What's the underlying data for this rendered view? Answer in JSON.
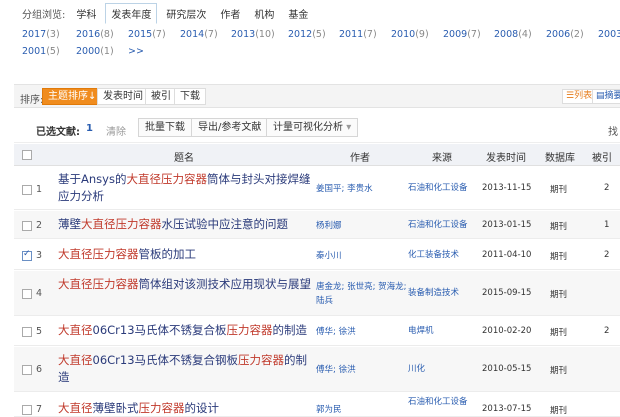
{
  "group_nav": {
    "label": "分组浏览:",
    "tabs": [
      {
        "label": "学科",
        "active": false
      },
      {
        "label": "发表年度",
        "active": true
      },
      {
        "label": "研究层次",
        "active": false
      },
      {
        "label": "作者",
        "active": false
      },
      {
        "label": "机构",
        "active": false
      },
      {
        "label": "基金",
        "active": false
      }
    ],
    "years": [
      {
        "year": "2017",
        "count": "(3)"
      },
      {
        "year": "2016",
        "count": "(8)"
      },
      {
        "year": "2015",
        "count": "(7)"
      },
      {
        "year": "2014",
        "count": "(7)"
      },
      {
        "year": "2013",
        "count": "(10)"
      },
      {
        "year": "2012",
        "count": "(5)"
      },
      {
        "year": "2011",
        "count": "(7)"
      },
      {
        "year": "2010",
        "count": "(9)"
      },
      {
        "year": "2009",
        "count": "(7)"
      },
      {
        "year": "2008",
        "count": "(4)"
      },
      {
        "year": "2006",
        "count": "(2)"
      },
      {
        "year": "2003",
        "count": ""
      },
      {
        "year": "2001",
        "count": "(5)"
      },
      {
        "year": "2000",
        "count": "(1)"
      },
      {
        "year": ">>",
        "count": ""
      }
    ]
  },
  "sort_bar": {
    "label": "排序:",
    "buttons": [
      {
        "label": "主题排序↓",
        "active": true
      },
      {
        "label": "发表时间",
        "active": false
      },
      {
        "label": "被引",
        "active": false
      },
      {
        "label": "下载",
        "active": false
      }
    ],
    "view_list": "☰列表",
    "view_abstract": "▤摘要"
  },
  "action_bar": {
    "selected_label": "已选文献:",
    "selected_count": "1",
    "clear_label": "清除",
    "batch_download": "批量下载",
    "export": "导出/参考文献",
    "visualize": "计量可视化分析",
    "visualize_caret": "▾",
    "right_text": "找"
  },
  "table": {
    "headers": {
      "title": "题名",
      "author": "作者",
      "source": "来源",
      "date": "发表时间",
      "db": "数据库",
      "cite": "被引"
    },
    "rows": [
      {
        "num": "1",
        "checked": false,
        "title_parts": [
          {
            "t": "基于Ansys的",
            "h": false
          },
          {
            "t": "大直径压力容器",
            "h": true
          },
          {
            "t": "筒体与封头对接焊缝应力分析",
            "h": false
          }
        ],
        "author": "姜国平; 李贵水",
        "source": "石油和化工设备",
        "date": "2013-11-15",
        "db": "期刊",
        "cite": "2"
      },
      {
        "num": "2",
        "checked": false,
        "title_parts": [
          {
            "t": "薄壁",
            "h": false
          },
          {
            "t": "大直径压力容器",
            "h": true
          },
          {
            "t": "水压试验中应注意的问题",
            "h": false
          }
        ],
        "author": "杨利娜",
        "source": "石油和化工设备",
        "date": "2013-01-15",
        "db": "期刊",
        "cite": "1"
      },
      {
        "num": "3",
        "checked": true,
        "title_parts": [
          {
            "t": "大直径压力容器",
            "h": true
          },
          {
            "t": "管板的加工",
            "h": false
          }
        ],
        "author": "秦小川",
        "source": "化工装备技术",
        "date": "2011-04-10",
        "db": "期刊",
        "cite": "2"
      },
      {
        "num": "4",
        "checked": false,
        "title_parts": [
          {
            "t": "大直径压力容器",
            "h": true
          },
          {
            "t": "筒体组对该测技术应用现状与展望",
            "h": false
          }
        ],
        "author": "唐金龙; 张世亮; 贺海龙; 陆兵",
        "source": "装备制造技术",
        "date": "2015-09-15",
        "db": "期刊",
        "cite": ""
      },
      {
        "num": "5",
        "checked": false,
        "title_parts": [
          {
            "t": "大直径",
            "h": true
          },
          {
            "t": "06Cr13马氏体不锈复合板",
            "h": false
          },
          {
            "t": "压力容器",
            "h": true
          },
          {
            "t": "的制造",
            "h": false
          }
        ],
        "author": "傅华; 徐洪",
        "source": "电焊机",
        "date": "2010-02-20",
        "db": "期刊",
        "cite": "2"
      },
      {
        "num": "6",
        "checked": false,
        "title_parts": [
          {
            "t": "大直径",
            "h": true
          },
          {
            "t": "06Cr13马氏体不锈复合钢板",
            "h": false
          },
          {
            "t": "压力容器",
            "h": true
          },
          {
            "t": "的制造",
            "h": false
          }
        ],
        "author": "傅华; 徐洪",
        "source": "川化",
        "date": "2010-05-15",
        "db": "期刊",
        "cite": ""
      },
      {
        "num": "7",
        "checked": false,
        "title_parts": [
          {
            "t": "大直径",
            "h": true
          },
          {
            "t": "薄壁卧式",
            "h": false
          },
          {
            "t": "压力容器",
            "h": true
          },
          {
            "t": "的设计",
            "h": false
          }
        ],
        "author": "郭为民",
        "source": "石油和化工设备",
        "date": "2013-07-15",
        "db": "期刊",
        "cite": ""
      }
    ]
  },
  "colors": {
    "accent": "#f08c1e",
    "link": "#2a5db0",
    "highlight": "#c0392b"
  }
}
